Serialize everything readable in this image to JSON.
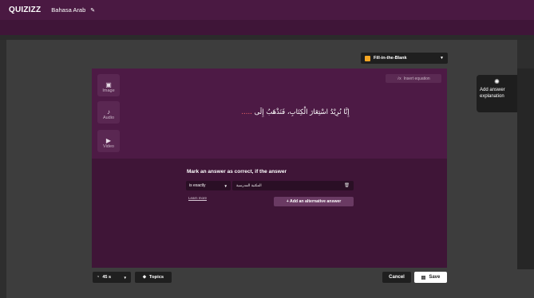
{
  "header": {
    "logo": "QUIZIZZ",
    "quiz_title": "Bahasa Arab",
    "edit_icon": "pencil-icon"
  },
  "question_type": {
    "label": "Fill-in-the-Blank",
    "icon": "blank-icon",
    "accent": "#f5a623"
  },
  "media": {
    "image_label": "Image",
    "audio_label": "Audio",
    "video_label": "Video"
  },
  "editor": {
    "insert_equation": "Insert equation",
    "question_text": "إِنَّا نُرِيْدُ اسْتِعَارَ الْكِتَابِ، فَنَذْهَبُ إِلَى",
    "blank": "....."
  },
  "answer": {
    "heading": "Mark an answer as correct, if the answer",
    "match_mode": "is exactly",
    "value": "المكتبة المدرسية",
    "learn_more": "Learn more",
    "add_alternative": "+ Add an alternative answer"
  },
  "explanation": {
    "label": "Add answer explanation",
    "icon": "lightbulb-icon"
  },
  "footer": {
    "timer": "45 s",
    "topics": "Topics",
    "cancel": "Cancel",
    "save": "Save"
  },
  "colors": {
    "brand_purple": "#4a1942",
    "card_purple": "#4d1a45"
  }
}
